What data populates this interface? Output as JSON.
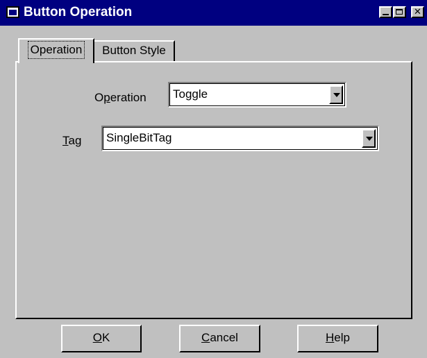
{
  "window": {
    "title": "Button Operation",
    "controls": {
      "minimize_icon": "minimize-icon",
      "maximize_icon": "maximize-icon",
      "close_glyph": "✕"
    },
    "colors": {
      "titlebar": "#000080",
      "face": "#c0c0c0"
    }
  },
  "tabs": [
    {
      "label": "Operation",
      "active": true
    },
    {
      "label": "Button Style",
      "active": false
    }
  ],
  "form": {
    "operation": {
      "label": "Operation",
      "mnemonic": "p",
      "value": "Toggle"
    },
    "tag": {
      "label": "Tag",
      "mnemonic": "T",
      "value": "SingleBitTag"
    }
  },
  "buttons": {
    "ok": {
      "label": "OK",
      "mnemonic": "O"
    },
    "cancel": {
      "label": "Cancel",
      "mnemonic": "C"
    },
    "help": {
      "label": "Help",
      "mnemonic": "H"
    }
  }
}
